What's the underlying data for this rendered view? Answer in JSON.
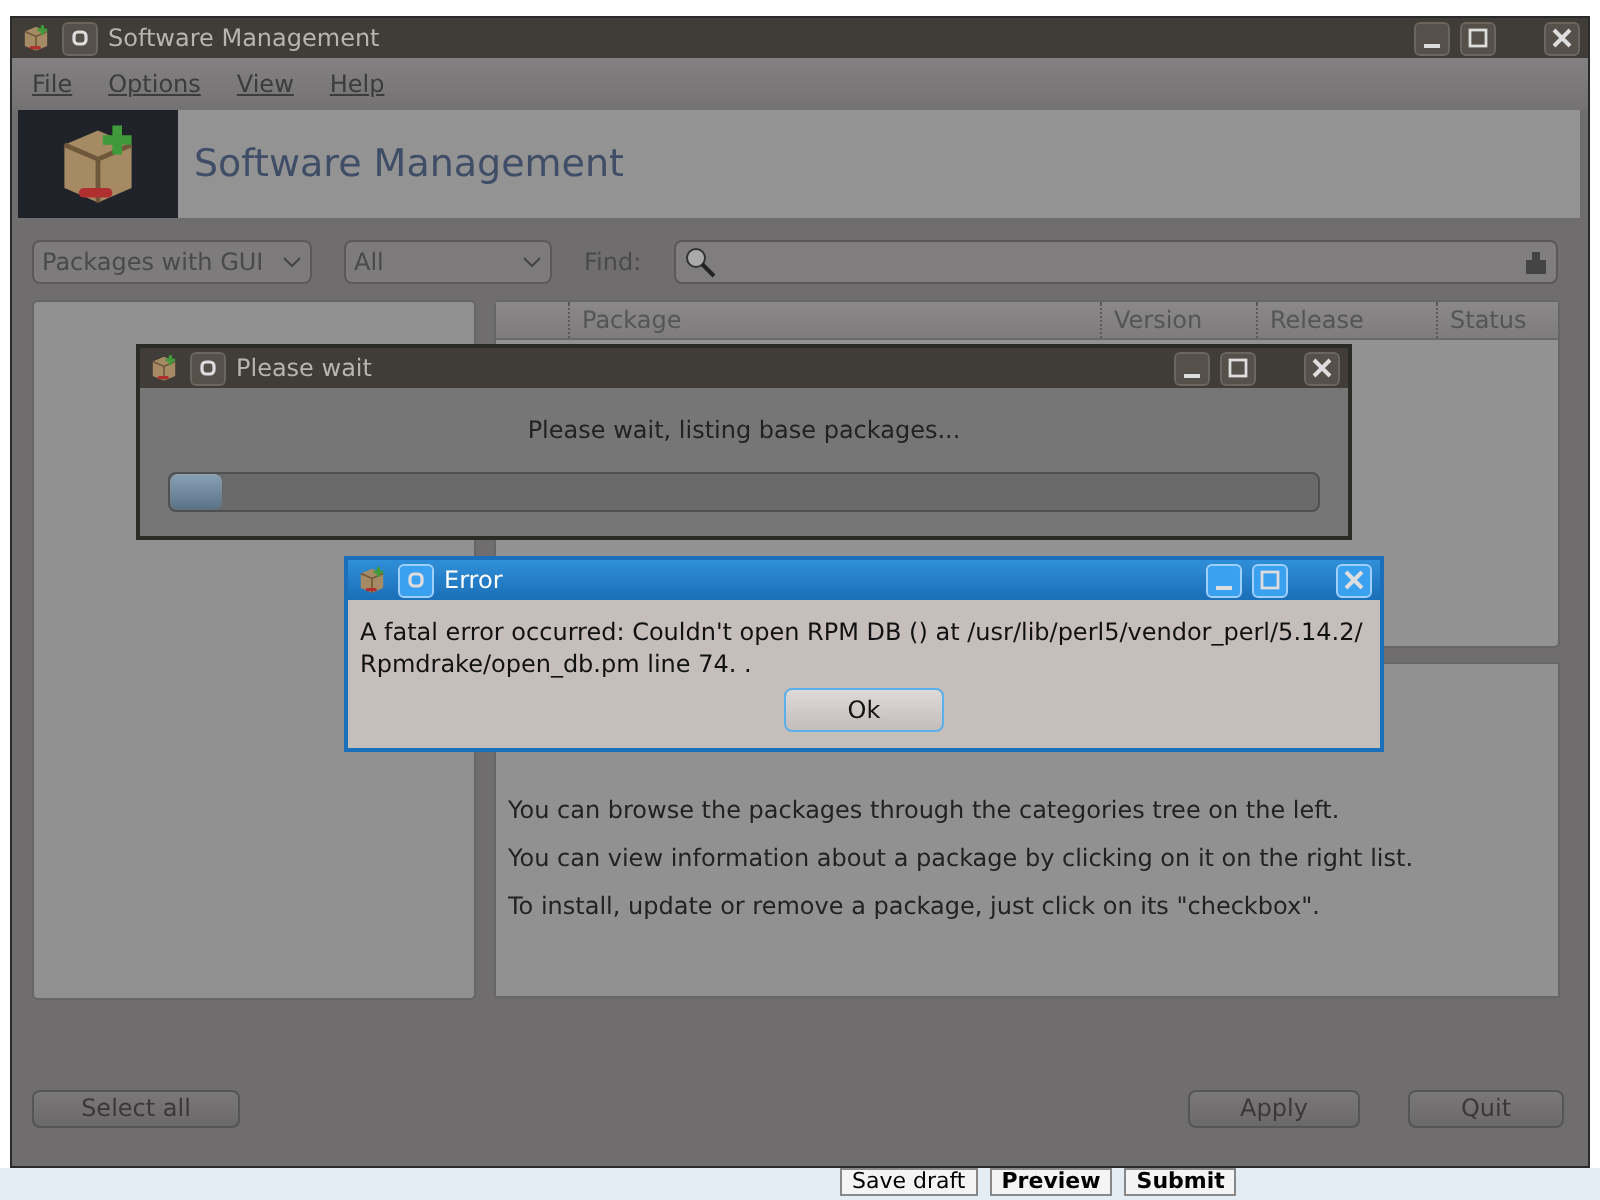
{
  "main_window": {
    "title": "Software Management",
    "menu": [
      "File",
      "Options",
      "View",
      "Help"
    ],
    "banner_title": "Software Management",
    "filters": [
      {
        "value": "Packages with GUI"
      },
      {
        "value": "All"
      }
    ],
    "find_label": "Find:",
    "table": {
      "columns": [
        "Package",
        "Version",
        "Release",
        "Status"
      ]
    },
    "intro": {
      "paragraphs": [
        "You can browse the packages through the categories tree on the left.",
        "You can view information about a package by clicking on it on the right list.",
        "To install, update or remove a package, just click on its \"checkbox\"."
      ]
    },
    "buttons": [
      {
        "label": "Select all",
        "disabled": true
      },
      {
        "label": "Apply",
        "disabled": true
      },
      {
        "label": "Quit",
        "disabled": true
      }
    ]
  },
  "wait_dialog": {
    "title": "Please wait",
    "message": "Please wait, listing base packages...",
    "level": 0.045
  },
  "error_dialog": {
    "title": "Error",
    "message": "A fatal error occurred: Couldn't open RPM DB () at /usr/lib/perl5/vendor_perl/5.14.2/ Rpmdrake/open_db.pm line 74. .",
    "button": "Ok"
  },
  "background_buttons": [
    "Save draft",
    "Preview",
    "Submit"
  ]
}
